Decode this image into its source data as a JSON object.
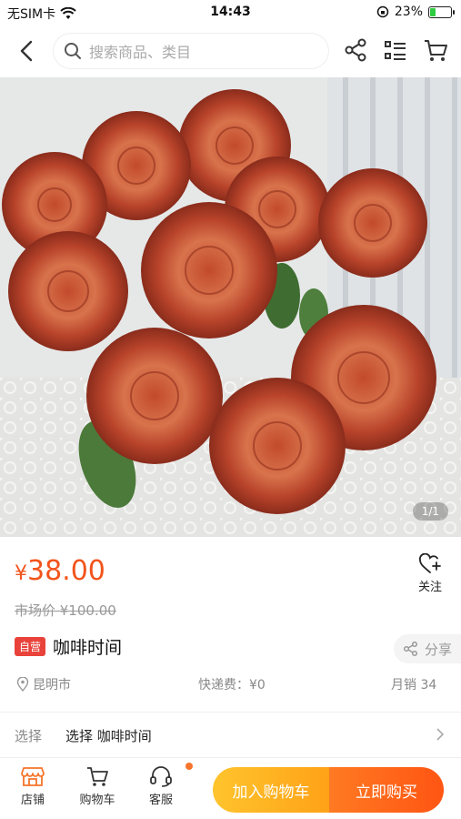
{
  "status_bar": {
    "carrier": "无SIM卡",
    "time": "14:43",
    "battery_percent": "23%",
    "battery_level": 0.23
  },
  "nav": {
    "search_placeholder": "搜索商品、类目",
    "icons": [
      "back-arrow-icon",
      "share-icon",
      "list-icon",
      "cart-icon"
    ]
  },
  "product": {
    "image_page": "1/1",
    "price_symbol": "¥",
    "price": "38.00",
    "market_price": "市场价 ¥100.00",
    "follow_label": "关注",
    "badge": "自营",
    "title": "咖啡时间",
    "share_label": "分享",
    "location": "昆明市",
    "shipping": "快递费：¥0",
    "monthly_sales": "月销 34",
    "select_label": "选择",
    "select_value": "选择 咖啡时间"
  },
  "bottom_bar": {
    "store": "店铺",
    "cart": "购物车",
    "service": "客服",
    "add_to_cart": "加入购物车",
    "buy_now": "立即购买"
  },
  "colors": {
    "price": "#f2541c",
    "badge": "#e8423a",
    "cart_button": "#ffb020",
    "buy_button": "#ff6a1a",
    "store_icon": "#f5742b"
  }
}
